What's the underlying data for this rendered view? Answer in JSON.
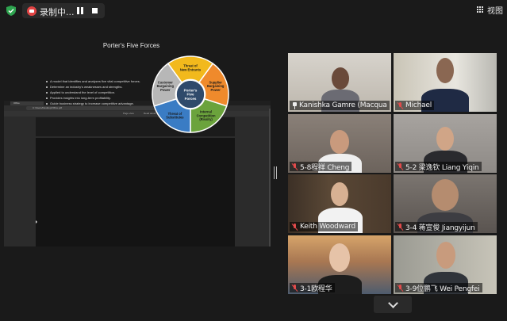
{
  "topbar": {
    "recording_label": "录制中...",
    "view_label": "视图"
  },
  "shared_screen": {
    "browser_tab": "Office",
    "address": "C:/Users/Desktop/Office.pdf",
    "toolbar_items": [
      "Page view",
      "Read aloud",
      "Add text",
      "Draw",
      "Highlight",
      "Erase"
    ],
    "slide": {
      "title": "Porter's Five Forces",
      "bullets": [
        "A model that identifies and analyzes five vital competitive forces.",
        "Determine an industry's weaknesses and strengths.",
        "Applied to understand the level of competition.",
        "Provides insights into long-term profitability.",
        "Guide business strategy to increase competitive advantage."
      ],
      "wheel": {
        "center": [
          "Porter's",
          "Five",
          "Forces"
        ],
        "segments": [
          {
            "label": [
              "Threat of",
              "New Entrants"
            ],
            "color": "#f2b91c"
          },
          {
            "label": [
              "Supplier",
              "Bargaining",
              "Power"
            ],
            "color": "#ef8a2c"
          },
          {
            "label": [
              "Internal",
              "Competition",
              "(Rivalry)"
            ],
            "color": "#6ba33c"
          },
          {
            "label": [
              "Threat of",
              "Substitutes"
            ],
            "color": "#3a7cc4"
          },
          {
            "label": [
              "Customer",
              "Bargaining",
              "Power"
            ],
            "color": "#b7b7b7"
          }
        ]
      }
    }
  },
  "participants": [
    {
      "name": "Kanishka Gamre (Macquarie...",
      "status": "pinned",
      "active": true
    },
    {
      "name": "Michael",
      "status": "muted"
    },
    {
      "name": "5-8程祥 Cheng",
      "status": "muted"
    },
    {
      "name": "5-2 梁逸钦 Liang Yiqin",
      "status": "muted"
    },
    {
      "name": "Keith Woodward",
      "status": "muted"
    },
    {
      "name": "3-4  蒋宣俊 Jiangyijun",
      "status": "muted"
    },
    {
      "name": "3-1欧程华",
      "status": "muted"
    },
    {
      "name": "3-9位鹏飞 Wei Pengfei",
      "status": "muted"
    }
  ],
  "colors": {
    "active_speaker": "#b2d33e",
    "muted_icon": "#e24b4b",
    "recording": "#e04343"
  }
}
